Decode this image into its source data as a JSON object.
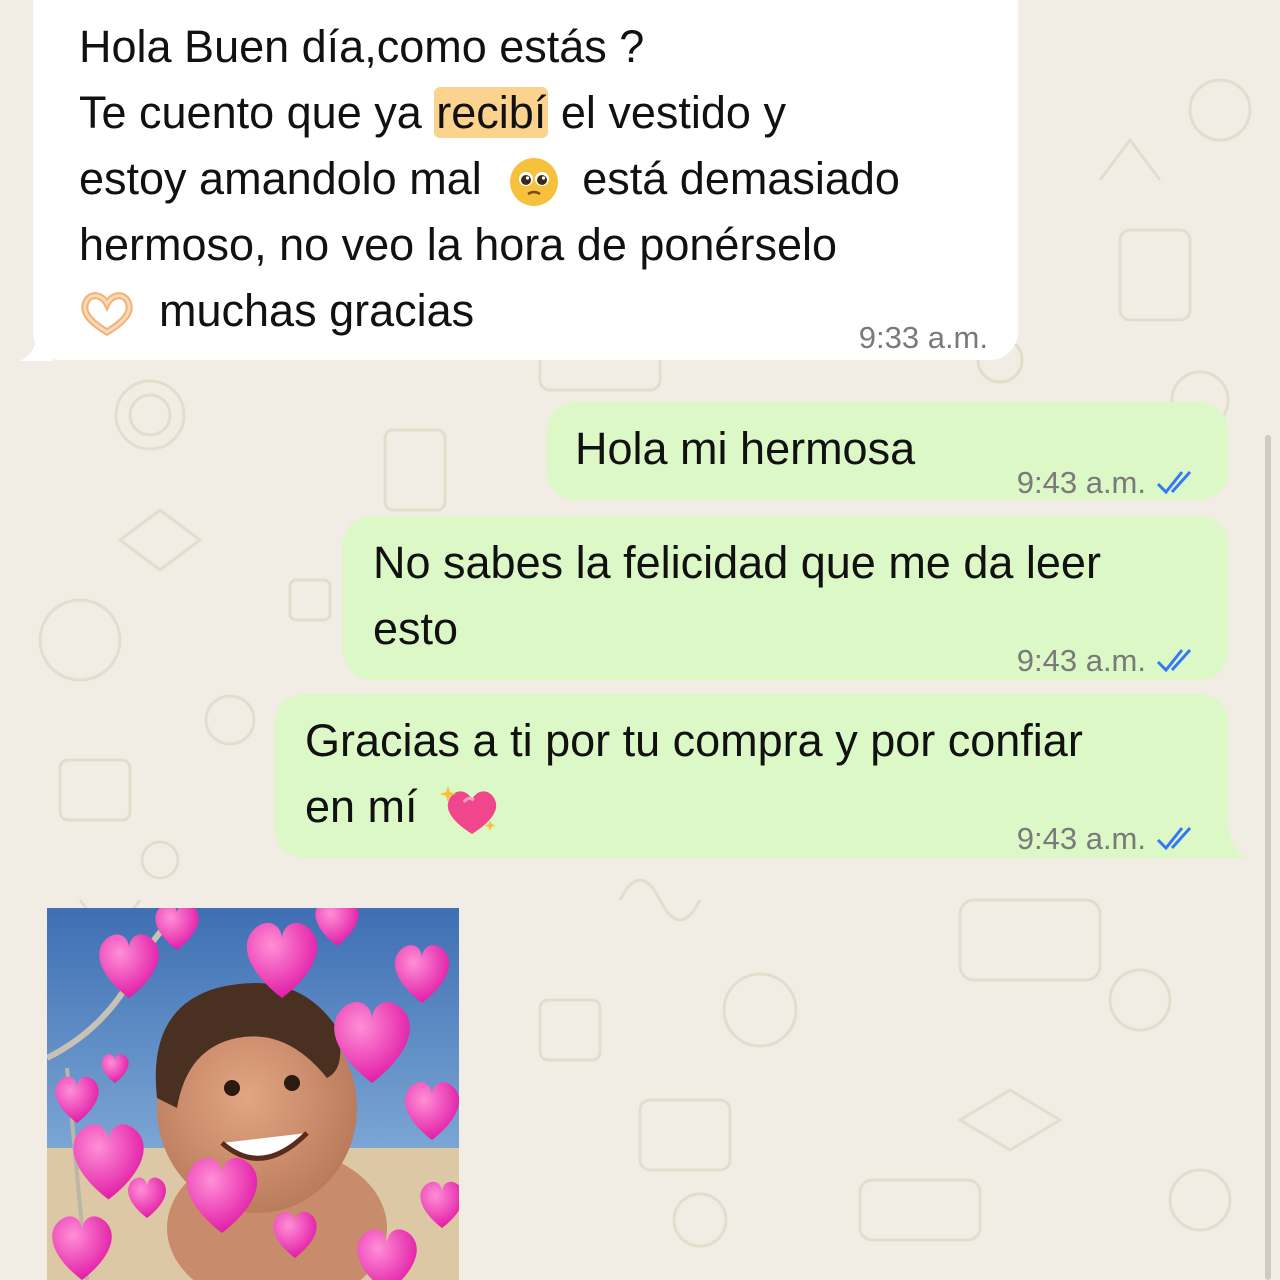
{
  "messages": [
    {
      "direction": "incoming",
      "lines": [
        "Hola Buen día,como estás ?",
        "Te cuento que ya",
        "recibí",
        "el vestido y",
        "estoy amandolo mal",
        "está demasiado",
        "hermoso, no veo la hora de ponérselo",
        "muchas gracias"
      ],
      "time": "9:33 a.m."
    },
    {
      "direction": "outgoing",
      "text": "Hola mi hermosa",
      "time": "9:43 a.m.",
      "status": "read"
    },
    {
      "direction": "outgoing",
      "lines": [
        "No sabes la felicidad que me da leer",
        "esto"
      ],
      "time": "9:43 a.m.",
      "status": "read"
    },
    {
      "direction": "outgoing",
      "lines": [
        "Gracias a ti por tu compra y por confiar",
        "en mí"
      ],
      "time": "9:43 a.m.",
      "status": "read"
    }
  ],
  "icons": {
    "pleading": "pleading-face-icon",
    "heart_hands": "heart-hands-icon",
    "sparkling_heart": "sparkling-heart-icon",
    "read_receipt": "double-check-icon"
  },
  "colors": {
    "incoming_bubble": "#ffffff",
    "outgoing_bubble": "#dcf8c6",
    "highlight": "#fbd38f",
    "read_check": "#3478f6",
    "wallpaper": "#f2ede4"
  }
}
